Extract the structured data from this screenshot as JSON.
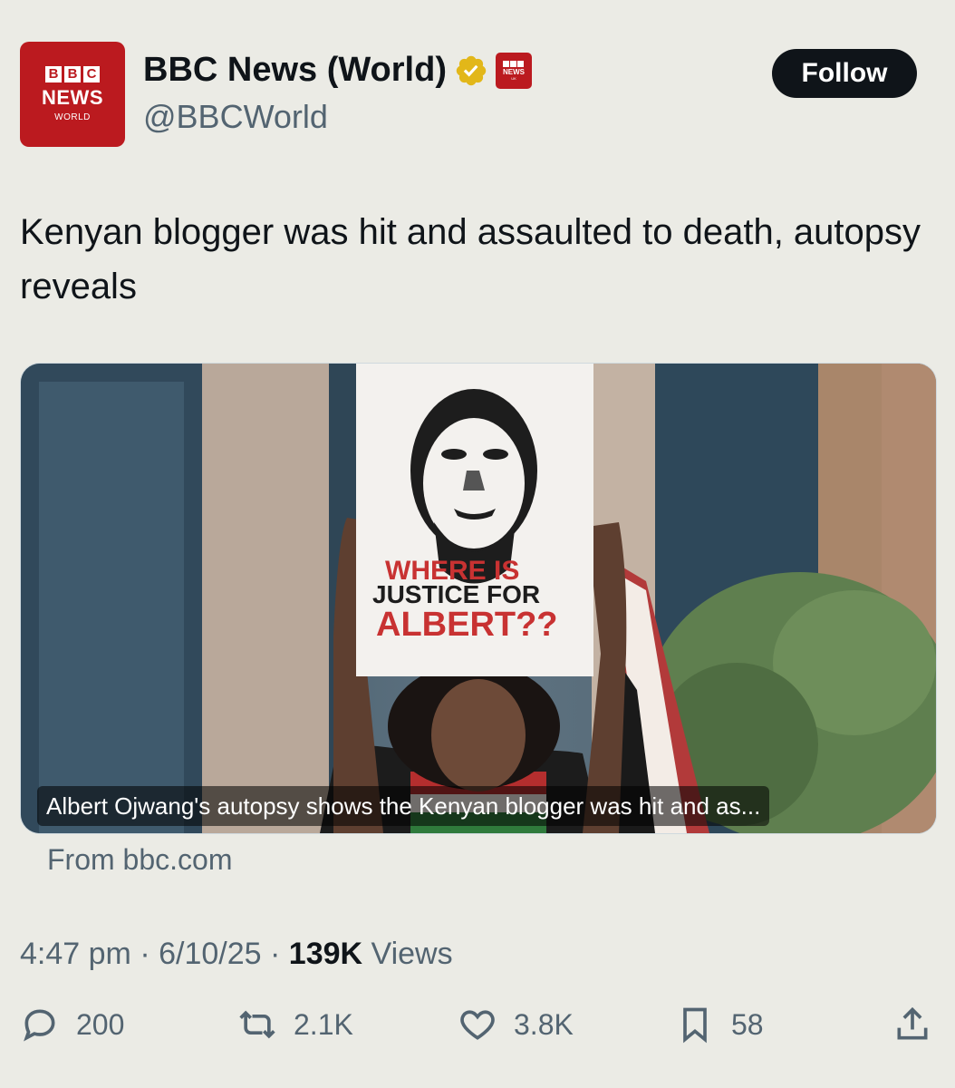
{
  "account": {
    "avatar": {
      "blocks": [
        "B",
        "B",
        "C"
      ],
      "news": "NEWS",
      "world": "WORLD"
    },
    "display_name": "BBC News (World)",
    "handle": "@BBCWorld",
    "affiliation_badge": {
      "news": "NEWS",
      "uk": "UK"
    },
    "follow_label": "Follow"
  },
  "tweet": {
    "text": "Kenyan blogger was hit and assaulted to death, autopsy reveals"
  },
  "card": {
    "image_sign": {
      "line1": "WHERE IS",
      "line2": "JUSTICE FOR",
      "line3": "ALBERT??"
    },
    "caption": "Albert Ojwang's autopsy shows the Kenyan blogger was hit and as...",
    "source": "From bbc.com"
  },
  "meta": {
    "time": "4:47 pm",
    "date": "6/10/25",
    "views_count": "139K",
    "views_label": "Views",
    "separator": "·"
  },
  "actions": {
    "replies": "200",
    "reposts": "2.1K",
    "likes": "3.8K",
    "bookmarks": "58"
  },
  "colors": {
    "background": "#ebebe5",
    "bbc_red": "#bb1a1f",
    "follow_bg": "#0f1419",
    "secondary_text": "#536471",
    "verified_gold": "#e2b719"
  }
}
